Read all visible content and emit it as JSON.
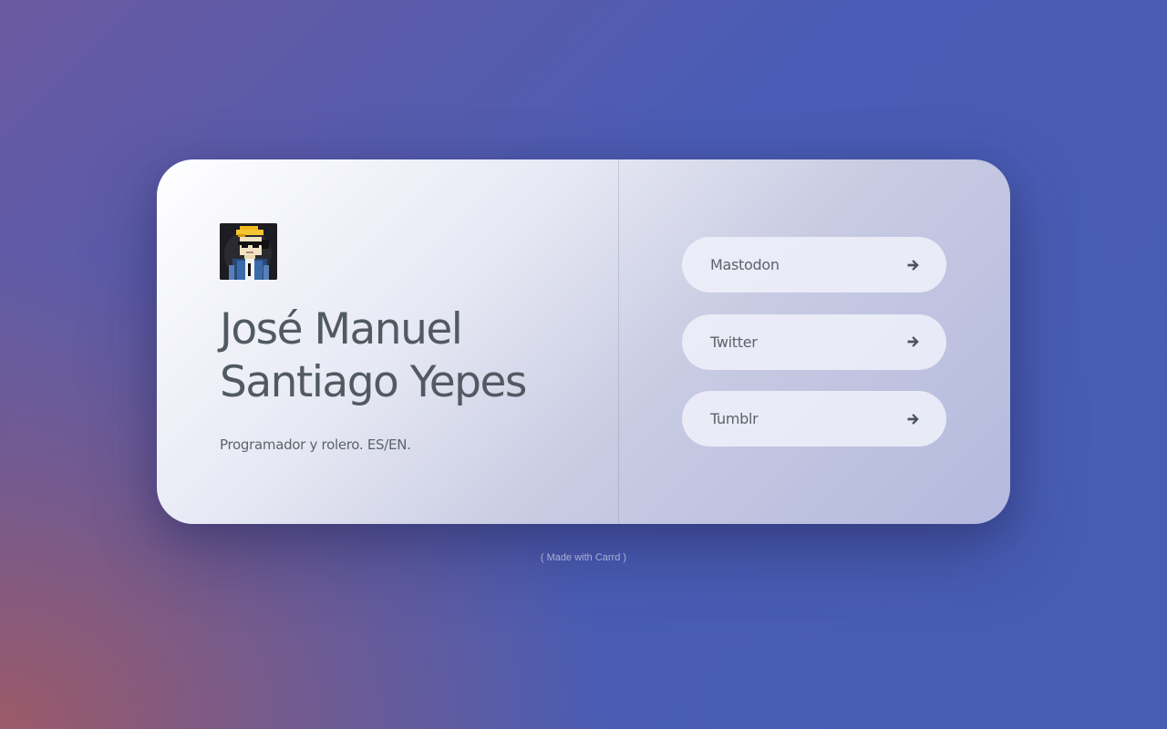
{
  "profile": {
    "avatar_icon": "pixel-art-portrait",
    "name_line1": "José Manuel",
    "name_line2": "Santiago Yepes",
    "tagline": "Programador y rolero. ES/EN."
  },
  "links": [
    {
      "label": "Mastodon",
      "icon": "arrow-right-icon"
    },
    {
      "label": "Twitter",
      "icon": "arrow-right-icon"
    },
    {
      "label": "Tumblr",
      "icon": "arrow-right-icon"
    }
  ],
  "footer": {
    "text": "( Made with Carrd )"
  },
  "colors": {
    "text": "#525a61",
    "background_blue": "#465db3",
    "background_red": "#a05a64",
    "button_bg": "#f0f1fa"
  }
}
